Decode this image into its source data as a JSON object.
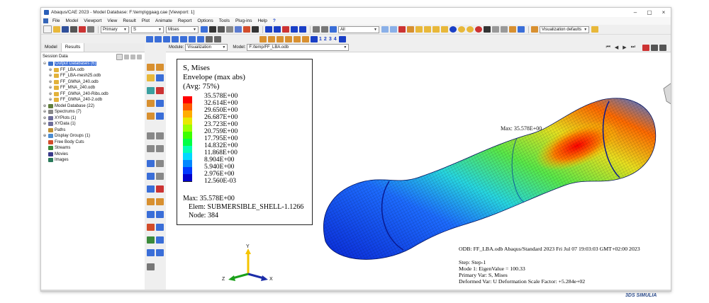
{
  "window": {
    "title": "Abaqus/CAE 2023 - Model Database: F:\\temp\\ggaag.cae [Viewport: 1]",
    "minimize": "–",
    "maximize": "▢",
    "close": "×"
  },
  "menu": {
    "items": [
      {
        "key": "file",
        "label": "File"
      },
      {
        "key": "model",
        "label": "Model"
      },
      {
        "key": "viewport",
        "label": "Viewport"
      },
      {
        "key": "view",
        "label": "View"
      },
      {
        "key": "result",
        "label": "Result"
      },
      {
        "key": "plot",
        "label": "Plot"
      },
      {
        "key": "animate",
        "label": "Animate"
      },
      {
        "key": "report",
        "label": "Report"
      },
      {
        "key": "options",
        "label": "Options"
      },
      {
        "key": "tools",
        "label": "Tools"
      },
      {
        "key": "plugins",
        "label": "Plug-ins"
      },
      {
        "key": "help",
        "label": "Help"
      }
    ],
    "help_cursor": "?"
  },
  "toolbar": {
    "primary_combo": "Primary",
    "variable_combo": "S",
    "invariant_combo": "Mises",
    "all_combo": "All",
    "viz_defaults_combo": "Visualization defaults",
    "steps": [
      "1",
      "2",
      "3",
      "4"
    ]
  },
  "left_panel": {
    "tabs": [
      "Model",
      "Results"
    ],
    "session_label": "Session Data",
    "tree": [
      {
        "label": "Output Databases (6)",
        "depth": 0,
        "toggle": "⊖",
        "icon": "database-icon",
        "color": "#3b6fc8",
        "selected": true
      },
      {
        "label": "FF_LBA.odb",
        "depth": 1,
        "toggle": "⊕",
        "icon": "odb-icon",
        "color": "#e2b23a"
      },
      {
        "label": "FF_LBA-mesh25.odb",
        "depth": 1,
        "toggle": "⊕",
        "icon": "odb-icon",
        "color": "#e2b23a"
      },
      {
        "label": "FF_GMNA_240.odb",
        "depth": 1,
        "toggle": "⊕",
        "icon": "odb-icon",
        "color": "#e2b23a"
      },
      {
        "label": "FF_MNA_240.odb",
        "depth": 1,
        "toggle": "⊕",
        "icon": "odb-icon",
        "color": "#e2b23a"
      },
      {
        "label": "FF_GMNA_240-Ribs.odb",
        "depth": 1,
        "toggle": "⊕",
        "icon": "odb-icon",
        "color": "#e2b23a"
      },
      {
        "label": "FF_GMNA_240-2.odb",
        "depth": 1,
        "toggle": "⊕",
        "icon": "odb-icon",
        "color": "#e2b23a"
      },
      {
        "label": "Model Database (22)",
        "depth": 0,
        "toggle": "⊕",
        "icon": "model-db-icon",
        "color": "#5f7d3a"
      },
      {
        "label": "Spectrums (7)",
        "depth": 0,
        "toggle": "⊕",
        "icon": "spectrum-icon",
        "color": "#888888"
      },
      {
        "label": "XYPlots (1)",
        "depth": 0,
        "toggle": "⊕",
        "icon": "xyplot-icon",
        "color": "#6d6d9a"
      },
      {
        "label": "XYData (1)",
        "depth": 0,
        "toggle": "⊕",
        "icon": "xydata-icon",
        "color": "#6d6d9a"
      },
      {
        "label": "Paths",
        "depth": 0,
        "toggle": "",
        "icon": "path-icon",
        "color": "#c09030"
      },
      {
        "label": "Display Groups (1)",
        "depth": 0,
        "toggle": "⊕",
        "icon": "display-group-icon",
        "color": "#4b8bd0"
      },
      {
        "label": "Free Body Cuts",
        "depth": 0,
        "toggle": "",
        "icon": "free-body-icon",
        "color": "#d24c2a"
      },
      {
        "label": "Streams",
        "depth": 0,
        "toggle": "",
        "icon": "stream-icon",
        "color": "#3a8a3a"
      },
      {
        "label": "Movies",
        "depth": 0,
        "toggle": "",
        "icon": "movie-icon",
        "color": "#3a3a8a"
      },
      {
        "label": "Images",
        "depth": 0,
        "toggle": "",
        "icon": "image-icon",
        "color": "#2a7a5a"
      }
    ]
  },
  "context": {
    "module_label": "Module:",
    "module_value": "Visualization",
    "model_label": "Model:",
    "model_value": "F:/temp/FF_LBA.odb"
  },
  "legend": {
    "title_lines": [
      "S, Mises",
      "Envelope (max abs)",
      "(Avg: 75%)"
    ],
    "values": [
      "35.578E+00",
      "32.614E+00",
      "29.650E+00",
      "26.687E+00",
      "23.723E+00",
      "20.759E+00",
      "17.795E+00",
      "14.832E+00",
      "11.868E+00",
      "8.904E+00",
      "5.940E+00",
      "2.976E+00",
      "12.560E-03"
    ],
    "colors": [
      "#ff0000",
      "#ff5a00",
      "#ffad00",
      "#e8e800",
      "#9cff00",
      "#3cff00",
      "#00ff45",
      "#00ffb3",
      "#00d7ff",
      "#0087ff",
      "#0038ff",
      "#0000cc"
    ],
    "max_line": "Max: 35.578E+00",
    "elem_line": "Elem: SUBMERSIBLE_SHELL-1.1266",
    "node_line": "Node: 384"
  },
  "annotation": {
    "max_label": "Max: 35.578E+00"
  },
  "triad": {
    "y": "Y",
    "z": "Z",
    "x": "X"
  },
  "info": {
    "odb_line": "ODB: FF_LBA.odb    Abaqus/Standard 2023    Fri Jul 07 19:03:03 GMT+02:00 2023",
    "step_line": "Step: Step-1",
    "mode_line": "Mode        1: EigenValue =  100.33",
    "primary_line": "Primary Var: S, Mises",
    "deformed_line": "Deformed Var: U   Deformation Scale Factor: +5.284e+02"
  },
  "brand": "3DS SIMULIA"
}
